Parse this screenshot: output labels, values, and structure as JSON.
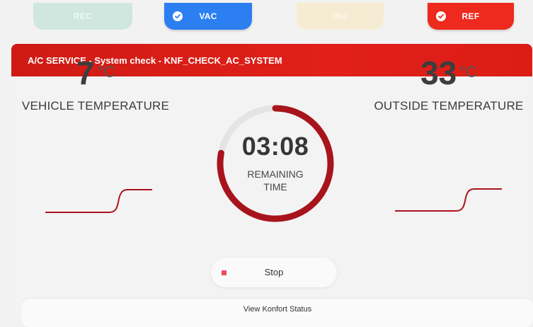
{
  "steps": [
    {
      "label": "REC",
      "state": "inactive"
    },
    {
      "label": "VAC",
      "state": "done"
    },
    {
      "label": "INJ",
      "state": "inactive"
    },
    {
      "label": "REF",
      "state": "done"
    }
  ],
  "header": {
    "title": "A/C SERVICE - System check - KNF_CHECK_AC_SYSTEM"
  },
  "vehicle": {
    "value": "7",
    "unit": "°C",
    "label": "VEHICLE TEMPERATURE"
  },
  "outside": {
    "value": "33",
    "unit": "°C",
    "label": "OUTSIDE TEMPERATURE"
  },
  "timer": {
    "time": "03:08",
    "label_line1": "REMAINING",
    "label_line2": "TIME",
    "progress": 0.78
  },
  "actions": {
    "stop_label": "Stop",
    "konfort_label": "View Konfort Status"
  },
  "colors": {
    "accent_red": "#d41c16",
    "arc_red": "#a8141c",
    "vac_blue": "#2c7ff0",
    "ref_red": "#ee2a1e",
    "stop_icon": "#ef4b5f"
  },
  "icons": {
    "step_done": "check-circle-icon",
    "stop": "stop-square-icon"
  }
}
